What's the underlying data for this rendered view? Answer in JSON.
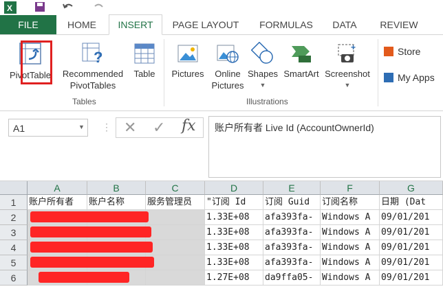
{
  "quick_access": {
    "app_icon": "excel-icon",
    "save_icon": "save-icon",
    "undo_icon": "undo-icon",
    "redo_icon": "redo-icon"
  },
  "tabs": [
    {
      "label": "FILE"
    },
    {
      "label": "HOME"
    },
    {
      "label": "INSERT"
    },
    {
      "label": "PAGE LAYOUT"
    },
    {
      "label": "FORMULAS"
    },
    {
      "label": "DATA"
    },
    {
      "label": "REVIEW"
    }
  ],
  "ribbon": {
    "tables": {
      "group_label": "Tables",
      "pivot_table": "PivotTable",
      "recommended_line1": "Recommended",
      "recommended_line2": "PivotTables",
      "table": "Table"
    },
    "illustrations": {
      "group_label": "Illustrations",
      "pictures": "Pictures",
      "online_line1": "Online",
      "online_line2": "Pictures",
      "shapes": "Shapes",
      "smartart": "SmartArt",
      "screenshot": "Screenshot"
    },
    "apps": {
      "store": "Store",
      "my_apps": "My Apps"
    }
  },
  "formula_bar": {
    "name_box": "A1",
    "content": "账户所有者 Live Id (AccountOwnerId)"
  },
  "sheet": {
    "columns": [
      "A",
      "B",
      "C",
      "D",
      "E",
      "F",
      "G"
    ],
    "rows": [
      "1",
      "2",
      "3",
      "4",
      "5",
      "6"
    ],
    "header_row": [
      "账户所有者",
      "账户名称",
      "服务管理员",
      "\"订阅 Id",
      "订阅 Guid",
      "订阅名称",
      "日期 (Dat"
    ],
    "data_rows": [
      [
        "",
        "",
        "",
        "1.33E+08",
        "afa393fa-",
        "Windows A",
        "09/01/201"
      ],
      [
        "",
        "",
        "",
        "1.33E+08",
        "afa393fa-",
        "Windows A",
        "09/01/201"
      ],
      [
        "",
        "",
        "",
        "1.33E+08",
        "afa393fa-",
        "Windows A",
        "09/01/201"
      ],
      [
        "",
        "",
        "",
        "1.33E+08",
        "afa393fa-",
        "Windows A",
        "09/01/201"
      ],
      [
        "",
        "",
        "",
        "1.27E+08",
        "da9ffa05-",
        "Windows A",
        "09/01/201"
      ]
    ]
  },
  "colors": {
    "accent": "#217346",
    "highlight_box": "#e02020",
    "redaction": "#ff2525"
  }
}
